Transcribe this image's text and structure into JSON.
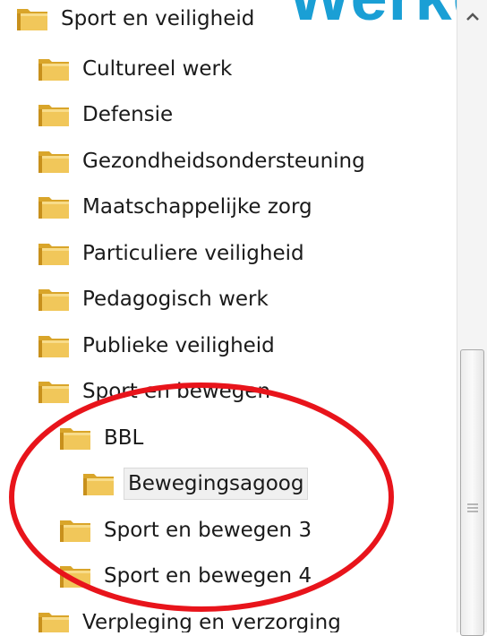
{
  "banner_text": "Werken toch n",
  "tree": {
    "items": [
      {
        "label": "Sport en veiligheid",
        "level": 0
      },
      {
        "label": "Cultureel werk",
        "level": 1
      },
      {
        "label": "Defensie",
        "level": 1
      },
      {
        "label": "Gezondheidsondersteuning",
        "level": 1
      },
      {
        "label": "Maatschappelijke zorg",
        "level": 1
      },
      {
        "label": "Particuliere veiligheid",
        "level": 1
      },
      {
        "label": "Pedagogisch werk",
        "level": 1
      },
      {
        "label": "Publieke veiligheid",
        "level": 1
      },
      {
        "label": "Sport en bewegen",
        "level": 1
      },
      {
        "label": "BBL",
        "level": 2
      },
      {
        "label": "Bewegingsagoog",
        "level": 3,
        "selected": true
      },
      {
        "label": "Sport en bewegen 3",
        "level": 2
      },
      {
        "label": "Sport en bewegen 4",
        "level": 2
      },
      {
        "label": "Verpleging en verzorging",
        "level": 1
      }
    ]
  },
  "colors": {
    "folder": "#e8b93a",
    "annotation": "#e8141b",
    "banner": "#1a9fd5"
  },
  "icons": {
    "folder": "folder-icon",
    "scroll_up": "chevron-up-icon",
    "grip": "grip-icon"
  }
}
